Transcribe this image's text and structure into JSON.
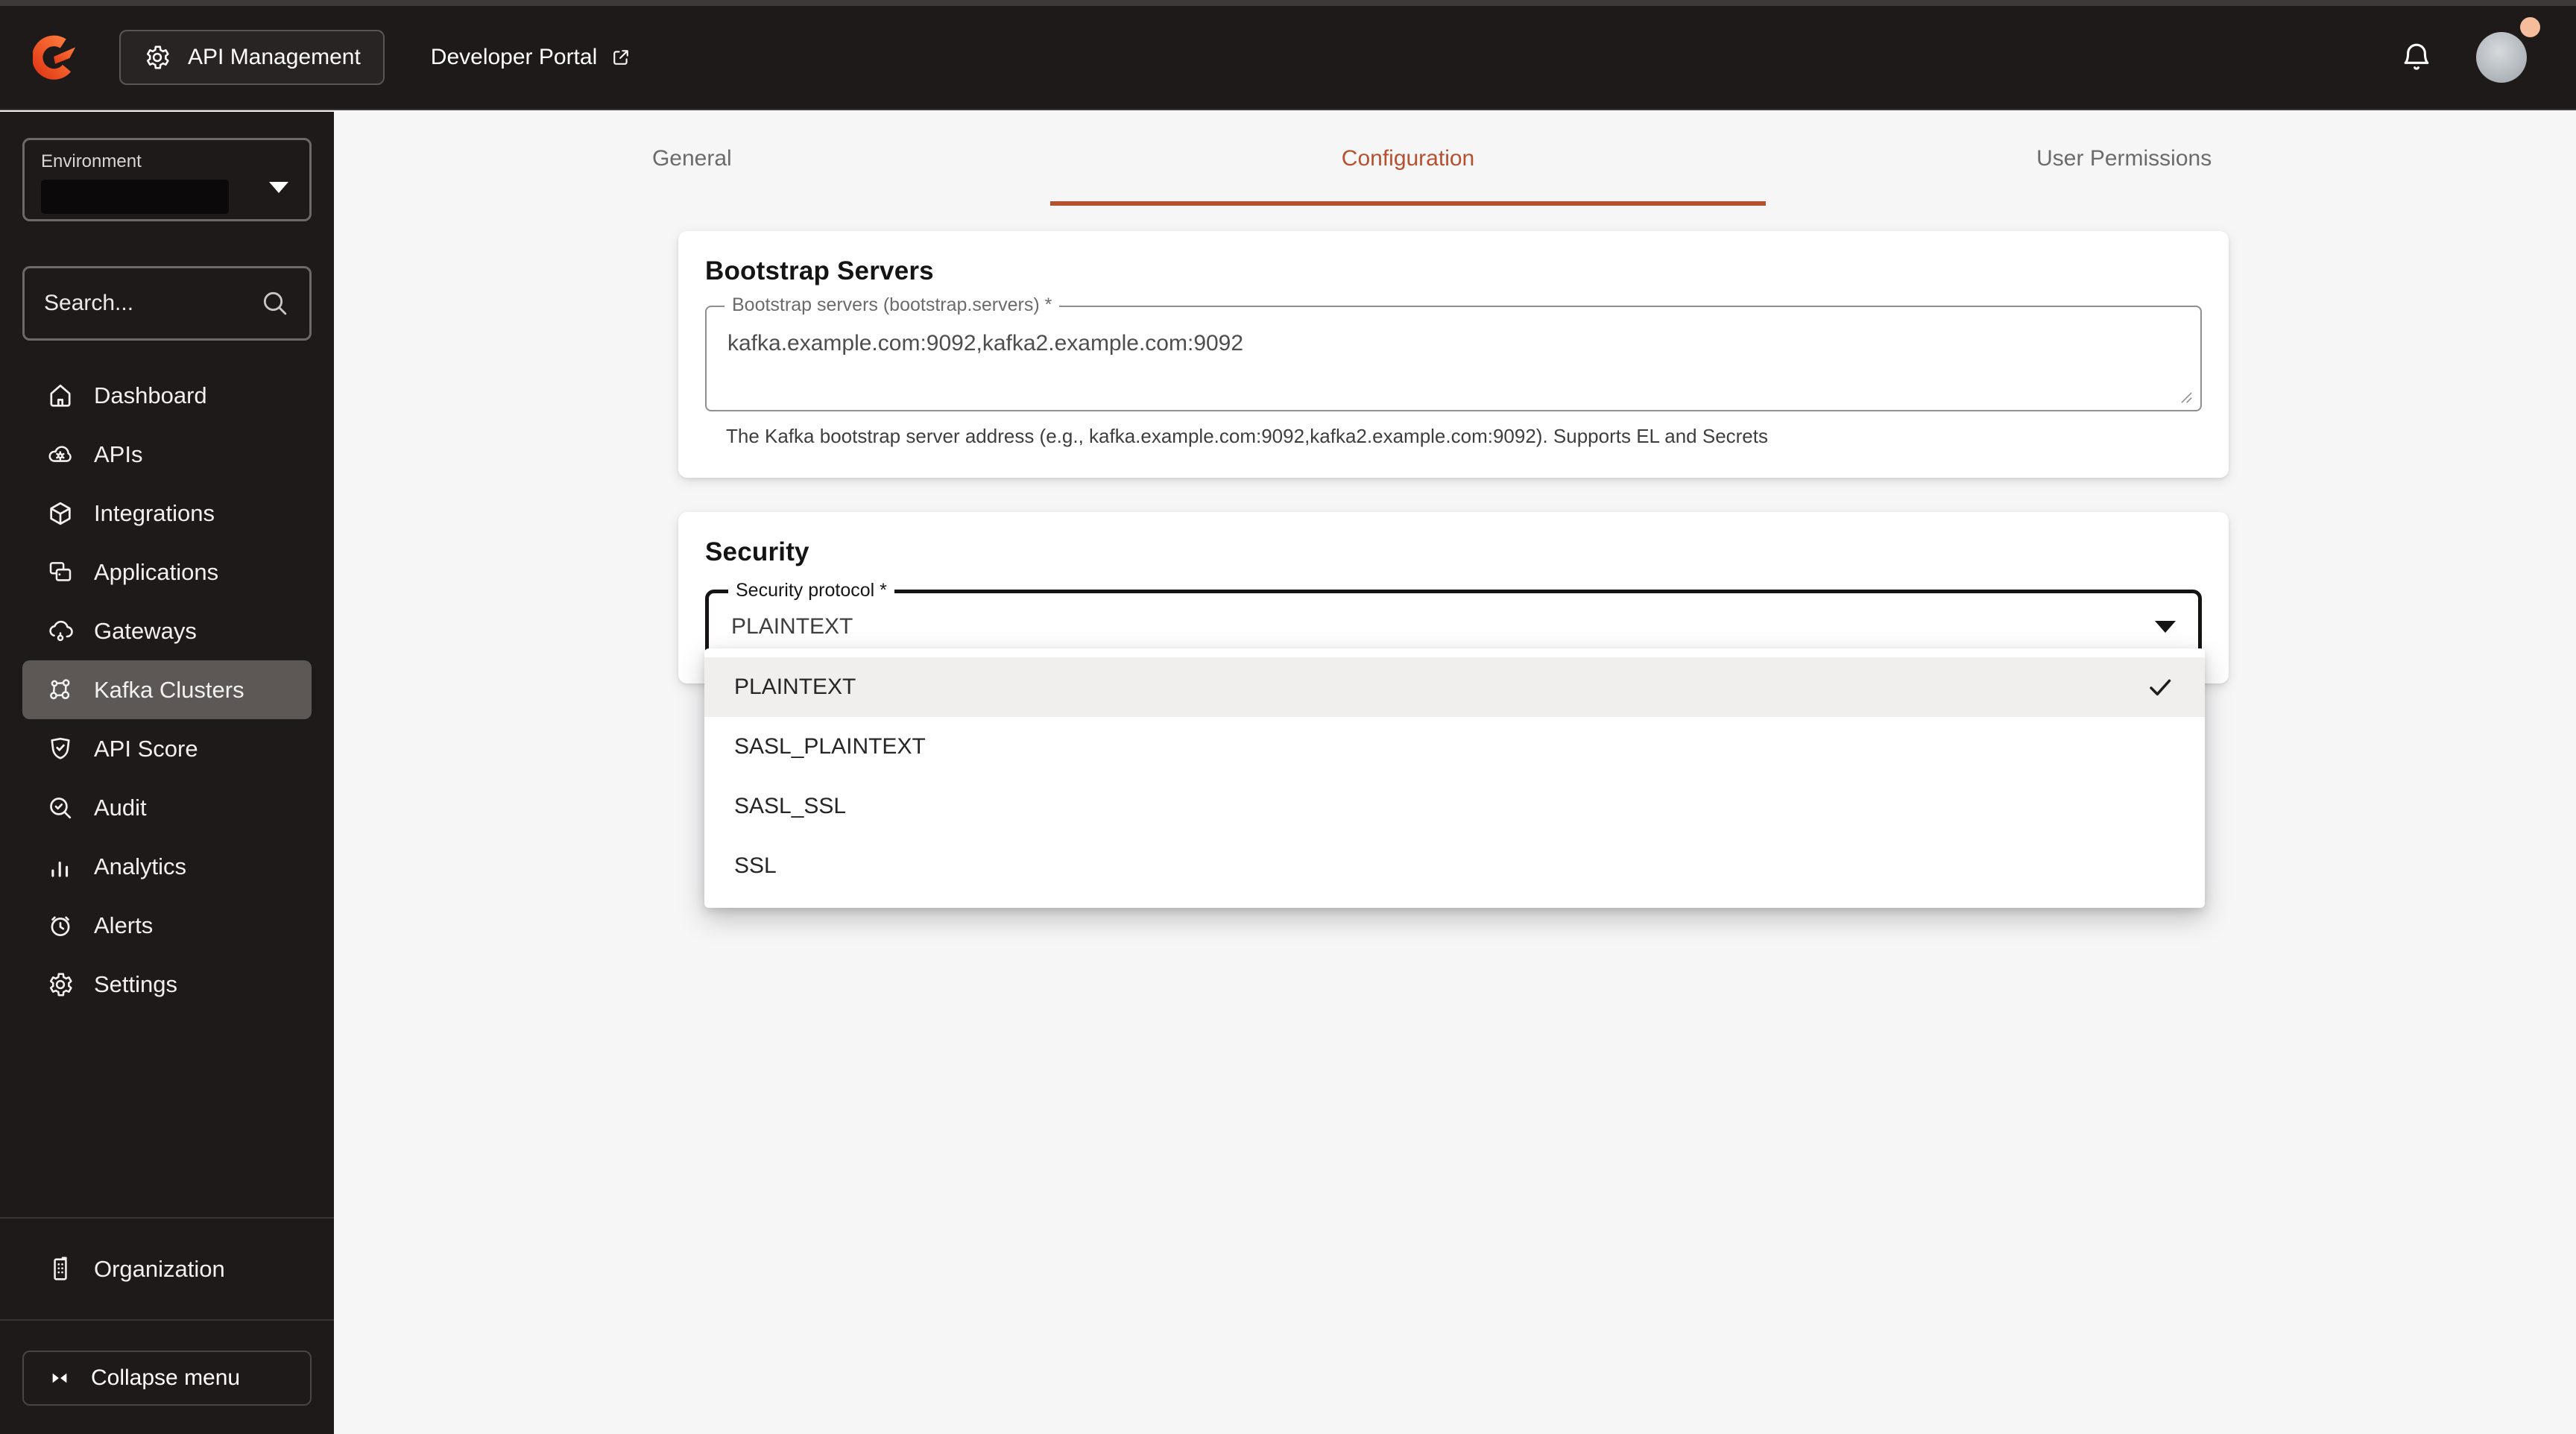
{
  "header": {
    "product_button": "API Management",
    "portal_link": "Developer Portal"
  },
  "sidebar": {
    "environment_label": "Environment",
    "search_placeholder": "Search...",
    "items": [
      {
        "label": "Dashboard"
      },
      {
        "label": "APIs"
      },
      {
        "label": "Integrations"
      },
      {
        "label": "Applications"
      },
      {
        "label": "Gateways"
      },
      {
        "label": "Kafka Clusters",
        "selected": true
      },
      {
        "label": "API Score"
      },
      {
        "label": "Audit"
      },
      {
        "label": "Analytics"
      },
      {
        "label": "Alerts"
      },
      {
        "label": "Settings"
      }
    ],
    "organization_label": "Organization",
    "collapse_label": "Collapse menu"
  },
  "tabs": [
    {
      "label": "General"
    },
    {
      "label": "Configuration",
      "active": true
    },
    {
      "label": "User Permissions"
    }
  ],
  "bootstrap_card": {
    "title": "Bootstrap Servers",
    "field_label": "Bootstrap servers (bootstrap.servers) *",
    "field_value": "kafka.example.com:9092,kafka2.example.com:9092",
    "helper": "The Kafka bootstrap server address (e.g., kafka.example.com:9092,kafka2.example.com:9092). Supports EL and Secrets"
  },
  "security_card": {
    "title": "Security",
    "select_label": "Security protocol *",
    "select_value": "PLAINTEXT",
    "options": [
      {
        "label": "PLAINTEXT",
        "selected": true
      },
      {
        "label": "SASL_PLAINTEXT"
      },
      {
        "label": "SASL_SSL"
      },
      {
        "label": "SSL"
      }
    ]
  },
  "colors": {
    "accent": "#b5512f",
    "header_bg": "#1d1a19",
    "selected_item_bg": "#5d5855",
    "badge": "#f6bd9c"
  }
}
